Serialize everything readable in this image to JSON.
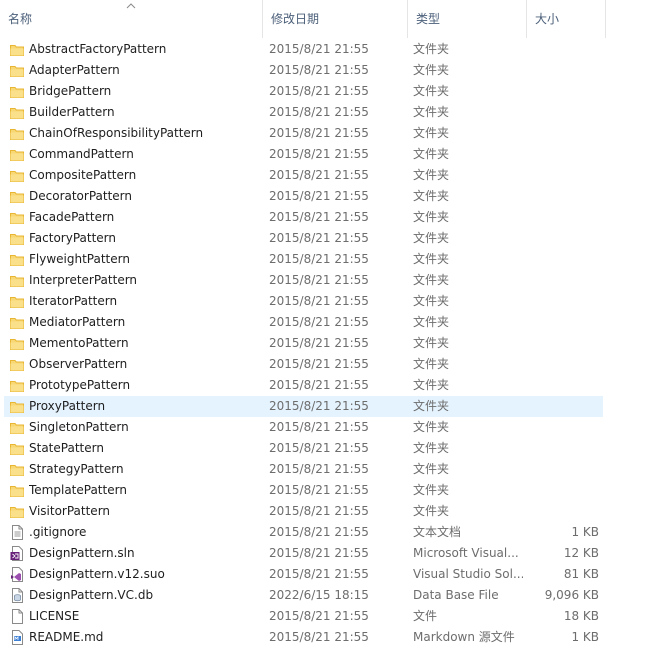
{
  "columns": {
    "name": "名称",
    "date": "修改日期",
    "type": "类型",
    "size": "大小"
  },
  "rows": [
    {
      "name": "AbstractFactoryPattern",
      "date": "2015/8/21 21:55",
      "type": "文件夹",
      "size": "",
      "icon": "folder-icon"
    },
    {
      "name": "AdapterPattern",
      "date": "2015/8/21 21:55",
      "type": "文件夹",
      "size": "",
      "icon": "folder-icon"
    },
    {
      "name": "BridgePattern",
      "date": "2015/8/21 21:55",
      "type": "文件夹",
      "size": "",
      "icon": "folder-icon"
    },
    {
      "name": "BuilderPattern",
      "date": "2015/8/21 21:55",
      "type": "文件夹",
      "size": "",
      "icon": "folder-icon"
    },
    {
      "name": "ChainOfResponsibilityPattern",
      "date": "2015/8/21 21:55",
      "type": "文件夹",
      "size": "",
      "icon": "folder-icon"
    },
    {
      "name": "CommandPattern",
      "date": "2015/8/21 21:55",
      "type": "文件夹",
      "size": "",
      "icon": "folder-icon"
    },
    {
      "name": "CompositePattern",
      "date": "2015/8/21 21:55",
      "type": "文件夹",
      "size": "",
      "icon": "folder-icon"
    },
    {
      "name": "DecoratorPattern",
      "date": "2015/8/21 21:55",
      "type": "文件夹",
      "size": "",
      "icon": "folder-icon"
    },
    {
      "name": "FacadePattern",
      "date": "2015/8/21 21:55",
      "type": "文件夹",
      "size": "",
      "icon": "folder-icon"
    },
    {
      "name": "FactoryPattern",
      "date": "2015/8/21 21:55",
      "type": "文件夹",
      "size": "",
      "icon": "folder-icon"
    },
    {
      "name": "FlyweightPattern",
      "date": "2015/8/21 21:55",
      "type": "文件夹",
      "size": "",
      "icon": "folder-icon"
    },
    {
      "name": "InterpreterPattern",
      "date": "2015/8/21 21:55",
      "type": "文件夹",
      "size": "",
      "icon": "folder-icon"
    },
    {
      "name": "IteratorPattern",
      "date": "2015/8/21 21:55",
      "type": "文件夹",
      "size": "",
      "icon": "folder-icon"
    },
    {
      "name": "MediatorPattern",
      "date": "2015/8/21 21:55",
      "type": "文件夹",
      "size": "",
      "icon": "folder-icon"
    },
    {
      "name": "MementoPattern",
      "date": "2015/8/21 21:55",
      "type": "文件夹",
      "size": "",
      "icon": "folder-icon"
    },
    {
      "name": "ObserverPattern",
      "date": "2015/8/21 21:55",
      "type": "文件夹",
      "size": "",
      "icon": "folder-icon"
    },
    {
      "name": "PrototypePattern",
      "date": "2015/8/21 21:55",
      "type": "文件夹",
      "size": "",
      "icon": "folder-icon"
    },
    {
      "name": "ProxyPattern",
      "date": "2015/8/21 21:55",
      "type": "文件夹",
      "size": "",
      "icon": "folder-icon",
      "selected": true
    },
    {
      "name": "SingletonPattern",
      "date": "2015/8/21 21:55",
      "type": "文件夹",
      "size": "",
      "icon": "folder-icon"
    },
    {
      "name": "StatePattern",
      "date": "2015/8/21 21:55",
      "type": "文件夹",
      "size": "",
      "icon": "folder-icon"
    },
    {
      "name": "StrategyPattern",
      "date": "2015/8/21 21:55",
      "type": "文件夹",
      "size": "",
      "icon": "folder-icon"
    },
    {
      "name": "TemplatePattern",
      "date": "2015/8/21 21:55",
      "type": "文件夹",
      "size": "",
      "icon": "folder-icon"
    },
    {
      "name": "VisitorPattern",
      "date": "2015/8/21 21:55",
      "type": "文件夹",
      "size": "",
      "icon": "folder-icon"
    },
    {
      "name": ".gitignore",
      "date": "2015/8/21 21:55",
      "type": "文本文档",
      "size": "1 KB",
      "icon": "text-file-icon"
    },
    {
      "name": "DesignPattern.sln",
      "date": "2015/8/21 21:55",
      "type": "Microsoft Visual...",
      "size": "12 KB",
      "icon": "visual-studio-solution-icon"
    },
    {
      "name": "DesignPattern.v12.suo",
      "date": "2015/8/21 21:55",
      "type": "Visual Studio Sol...",
      "size": "81 KB",
      "icon": "visual-studio-options-icon"
    },
    {
      "name": "DesignPattern.VC.db",
      "date": "2022/6/15 18:15",
      "type": "Data Base File",
      "size": "9,096 KB",
      "icon": "database-file-icon"
    },
    {
      "name": "LICENSE",
      "date": "2015/8/21 21:55",
      "type": "文件",
      "size": "18 KB",
      "icon": "blank-file-icon"
    },
    {
      "name": "README.md",
      "date": "2015/8/21 21:55",
      "type": "Markdown 源文件",
      "size": "1 KB",
      "icon": "markdown-file-icon"
    }
  ],
  "colors": {
    "selected_row": "#e5f3ff",
    "header_text": "#4c607a",
    "folder": "#f8d775",
    "folder_dark": "#e8b632",
    "vs_purple": "#68217a"
  }
}
